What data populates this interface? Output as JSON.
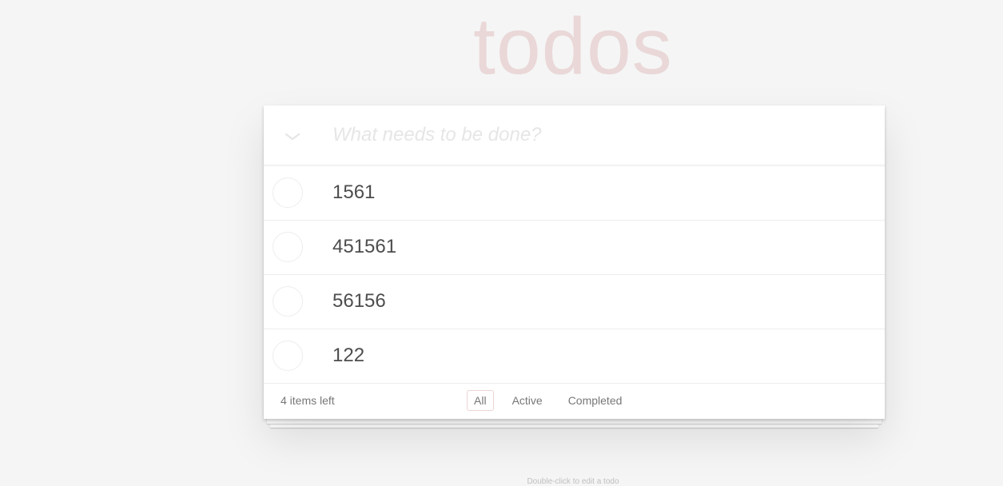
{
  "header": {
    "title": "todos",
    "input_placeholder": "What needs to be done?",
    "input_value": ""
  },
  "todos": [
    {
      "label": "1561",
      "completed": false
    },
    {
      "label": "451561",
      "completed": false
    },
    {
      "label": "56156",
      "completed": false
    },
    {
      "label": "122",
      "completed": false
    }
  ],
  "footer": {
    "count_text": "4 items left",
    "filters": [
      {
        "label": "All",
        "selected": true
      },
      {
        "label": "Active",
        "selected": false
      },
      {
        "label": "Completed",
        "selected": false
      }
    ]
  },
  "info": {
    "hint": "Double-click to edit a todo"
  },
  "colors": {
    "background": "#f5f5f5",
    "title": "rgba(175,47,47,0.15)",
    "text": "#4d4d4d",
    "placeholder": "#e6e6e6",
    "selected_filter_border": "rgba(175,47,47,0.2)"
  },
  "icons": {
    "toggle_all": "chevron-down-icon"
  }
}
